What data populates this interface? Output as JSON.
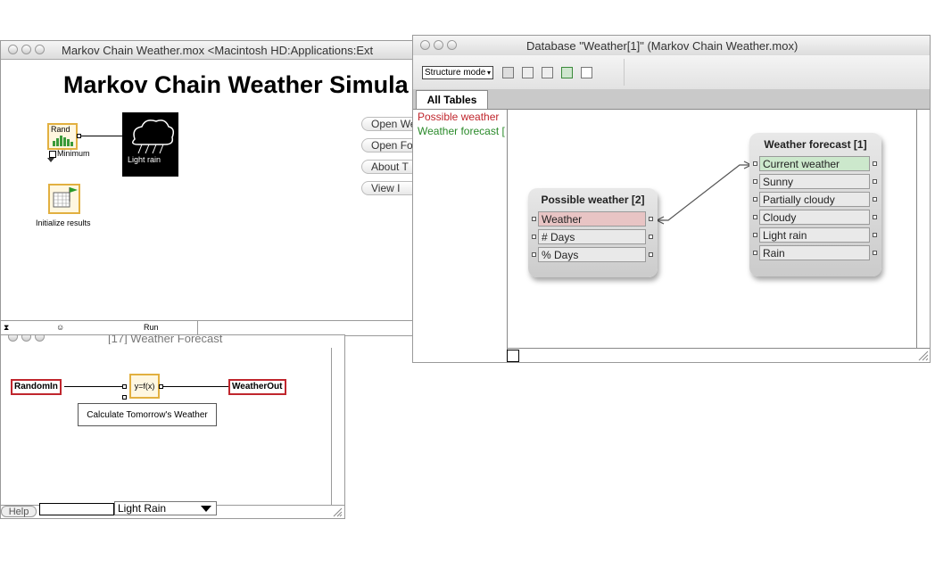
{
  "win1": {
    "title": "Markov Chain Weather.mox    <Macintosh HD:Applications:Ext",
    "heading": "Markov Chain Weather Simula",
    "rand_label": "Rand",
    "minimum_label": "Minimum",
    "cloud_label": "Light rain",
    "init_label": "Initialize results",
    "buttons": [
      "Open We",
      "Open Fo",
      "About T",
      "View I"
    ],
    "status_run": "Run"
  },
  "win2": {
    "title": "[17]  Weather Forecast",
    "random_in": "RandomIn",
    "weather_out": "WeatherOut",
    "func_label": "y=f(x)",
    "calc_label": "Calculate Tomorrow's Weather",
    "help_label": "Help",
    "select_value": "Light Rain"
  },
  "win3": {
    "title": "Database \"Weather[1]\" (Markov Chain Weather.mox)",
    "mode": "Structure mode",
    "tab": "All Tables",
    "tables": [
      "Possible weather",
      "Weather forecast ["
    ],
    "possible": {
      "title": "Possible weather [2]",
      "fields": [
        "Weather",
        "# Days",
        "% Days"
      ]
    },
    "forecast": {
      "title": "Weather forecast [1]",
      "fields": [
        "Current weather",
        "Sunny",
        "Partially cloudy",
        "Cloudy",
        "Light rain",
        "Rain"
      ]
    }
  },
  "colors": {
    "io_border": "#c0262d",
    "possible_title": "#c0262d",
    "forecast_title": "#2a8a2a",
    "weather_highlight": "#e8c4c4",
    "current_weather_highlight": "#cce8cc"
  }
}
